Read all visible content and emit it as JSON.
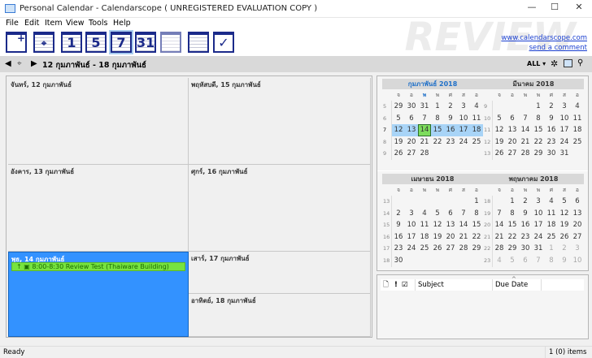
{
  "window": {
    "title": "Personal Calendar - Calendarscope ( UNREGISTERED EVALUATION COPY )",
    "minimize": "—",
    "maximize": "☐",
    "close": "✕"
  },
  "menu": [
    "File",
    "Edit",
    "Item",
    "View",
    "Tools",
    "Help"
  ],
  "toolbar": [
    {
      "name": "new-item",
      "label": ""
    },
    {
      "name": "go-today",
      "label": ""
    },
    {
      "name": "day-view",
      "label": "1"
    },
    {
      "name": "work-week-view",
      "label": "5"
    },
    {
      "name": "week-view",
      "label": "7"
    },
    {
      "name": "month-view",
      "label": "31"
    },
    {
      "name": "year-view",
      "label": ""
    },
    {
      "name": "list-view",
      "label": ""
    },
    {
      "name": "tasks-view",
      "label": "✓"
    }
  ],
  "links": {
    "website": "www.calendarscope.com",
    "comment": "send a comment"
  },
  "watermark": "THAIWARE REVIEW",
  "nav": {
    "range": "12 กุมภาพันธ์ - 18 กุมภาพันธ์",
    "filter": "ALL ▾"
  },
  "week": {
    "mon": "จันทร์, 12 กุมภาพันธ์",
    "tue": "อังคาร, 13 กุมภาพันธ์",
    "wed": "พุธ, 14 กุมภาพันธ์",
    "thu": "พฤหัสบดี, 15 กุมภาพันธ์",
    "fri": "ศุกร์, 16 กุมภาพันธ์",
    "sat": "เสาร์, 17 กุมภาพันธ์",
    "sun": "อาทิตย์, 18 กุมภาพันธ์",
    "event": "8:00-8:30 Review Test (Thaiware Building)"
  },
  "daynames": [
    "จ",
    "อ",
    "พ",
    "พ",
    "ศ",
    "ส",
    "อ"
  ],
  "months": [
    {
      "title": "กุมภาพันธ์ 2018",
      "current": true,
      "weeks": [
        {
          "no": "5",
          "days": [
            "29",
            "30",
            "31",
            "1",
            "2",
            "3",
            "4"
          ]
        },
        {
          "no": "6",
          "days": [
            "5",
            "6",
            "7",
            "8",
            "9",
            "10",
            "11"
          ]
        },
        {
          "no": "7",
          "days": [
            "12",
            "13",
            "14",
            "15",
            "16",
            "17",
            "18"
          ],
          "highlight": true,
          "today": 2
        },
        {
          "no": "8",
          "days": [
            "19",
            "20",
            "21",
            "22",
            "23",
            "24",
            "25"
          ]
        },
        {
          "no": "9",
          "days": [
            "26",
            "27",
            "28",
            "",
            "",
            "",
            ""
          ]
        }
      ]
    },
    {
      "title": "มีนาคม 2018",
      "weeks": [
        {
          "no": "9",
          "days": [
            "",
            "",
            "",
            "1",
            "2",
            "3",
            "4"
          ]
        },
        {
          "no": "10",
          "days": [
            "5",
            "6",
            "7",
            "8",
            "9",
            "10",
            "11"
          ]
        },
        {
          "no": "11",
          "days": [
            "12",
            "13",
            "14",
            "15",
            "16",
            "17",
            "18"
          ]
        },
        {
          "no": "12",
          "days": [
            "19",
            "20",
            "21",
            "22",
            "23",
            "24",
            "25"
          ]
        },
        {
          "no": "13",
          "days": [
            "26",
            "27",
            "28",
            "29",
            "30",
            "31",
            ""
          ]
        }
      ]
    },
    {
      "title": "เมษายน 2018",
      "weeks": [
        {
          "no": "13",
          "days": [
            "",
            "",
            "",
            "",
            "",
            "",
            "1"
          ]
        },
        {
          "no": "14",
          "days": [
            "2",
            "3",
            "4",
            "5",
            "6",
            "7",
            "8"
          ]
        },
        {
          "no": "15",
          "days": [
            "9",
            "10",
            "11",
            "12",
            "13",
            "14",
            "15"
          ]
        },
        {
          "no": "16",
          "days": [
            "16",
            "17",
            "18",
            "19",
            "20",
            "21",
            "22"
          ]
        },
        {
          "no": "17",
          "days": [
            "23",
            "24",
            "25",
            "26",
            "27",
            "28",
            "29"
          ]
        },
        {
          "no": "18",
          "days": [
            "30",
            "",
            "",
            "",
            "",
            "",
            ""
          ]
        }
      ]
    },
    {
      "title": "พฤษภาคม 2018",
      "weeks": [
        {
          "no": "18",
          "days": [
            "",
            "1",
            "2",
            "3",
            "4",
            "5",
            "6"
          ]
        },
        {
          "no": "19",
          "days": [
            "7",
            "8",
            "9",
            "10",
            "11",
            "12",
            "13"
          ]
        },
        {
          "no": "20",
          "days": [
            "14",
            "15",
            "16",
            "17",
            "18",
            "19",
            "20"
          ]
        },
        {
          "no": "21",
          "days": [
            "21",
            "22",
            "23",
            "24",
            "25",
            "26",
            "27"
          ]
        },
        {
          "no": "22",
          "days": [
            "28",
            "29",
            "30",
            "31",
            "1",
            "2",
            "3"
          ],
          "muted": [
            4,
            5,
            6
          ]
        },
        {
          "no": "23",
          "days": [
            "4",
            "5",
            "6",
            "7",
            "8",
            "9",
            "10"
          ],
          "muted": [
            0,
            1,
            2,
            3,
            4,
            5,
            6
          ]
        }
      ]
    }
  ],
  "tasks": {
    "col_subject": "Subject",
    "col_due": "Due Date",
    "sort": "^"
  },
  "status": {
    "left": "Ready",
    "right": "1 (0) items"
  }
}
